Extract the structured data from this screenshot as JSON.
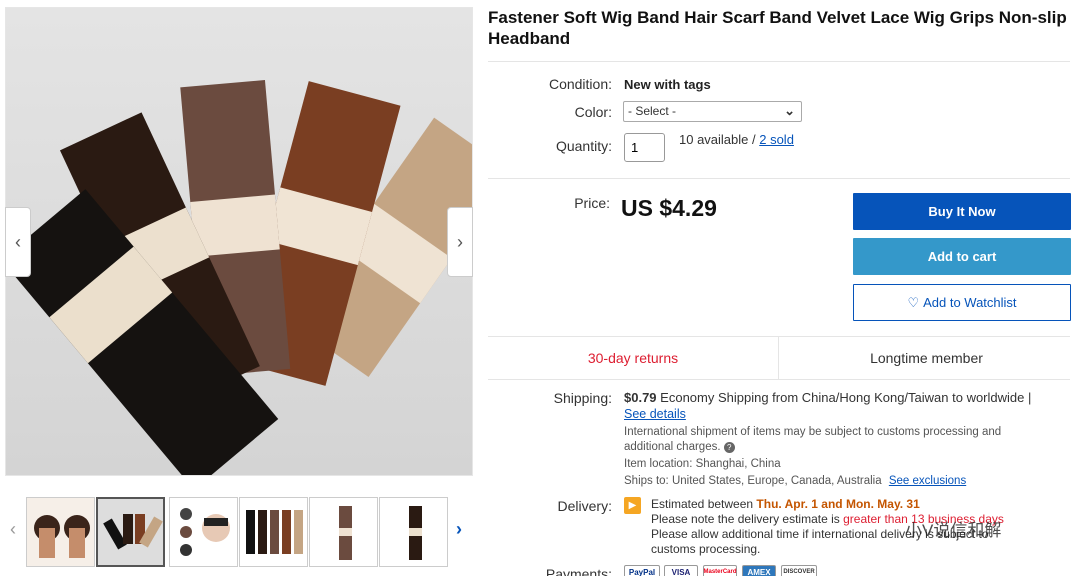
{
  "title": "Fastener Soft Wig Band Hair Scarf Band Velvet Lace Wig Grips Non-slip Headband",
  "condition": {
    "label": "Condition:",
    "value": "New with tags"
  },
  "color": {
    "label": "Color:",
    "selected": "- Select -"
  },
  "quantity": {
    "label": "Quantity:",
    "value": "1",
    "available": "10 available / ",
    "sold": "2 sold"
  },
  "price": {
    "label": "Price:",
    "value": "US $4.29"
  },
  "buttons": {
    "buy": "Buy It Now",
    "cart": "Add to cart",
    "watch": "Add to Watchlist"
  },
  "badges": {
    "returns": "30-day returns",
    "member": "Longtime member"
  },
  "shipping": {
    "label": "Shipping:",
    "cost": "$0.79",
    "desc": "Economy Shipping from China/Hong Kong/Taiwan to worldwide |",
    "details_link": "See details",
    "intl_note": "International shipment of items may be subject to customs processing and additional charges.",
    "location": "Item location: Shanghai, China",
    "ships_to": "Ships to: United States, Europe, Canada, Australia",
    "exclusions_link": "See exclusions"
  },
  "delivery": {
    "label": "Delivery:",
    "line1_prefix": "Estimated between ",
    "line1_dates": "Thu. Apr. 1 and Mon. May. 31",
    "line2_prefix": "Please note the delivery estimate is ",
    "line2_highlight": "greater than 13 business days",
    "line3": "Please allow additional time if international delivery is subject to",
    "line4": "customs processing."
  },
  "payments": {
    "label": "Payments:",
    "methods": [
      "PayPal",
      "VISA",
      "MasterCard",
      "AMEX",
      "DISCOVER"
    ]
  },
  "watermark": "小V说信和解",
  "colors": {
    "accent": "#0654ba",
    "cart": "#3498ca",
    "returns": "#dd1e31",
    "delivery": "#c45500"
  },
  "icons": {
    "prev": "chevron-left-icon",
    "next": "chevron-right-icon",
    "watch": "heart-icon",
    "info": "info-icon",
    "flag": "flag-icon"
  }
}
